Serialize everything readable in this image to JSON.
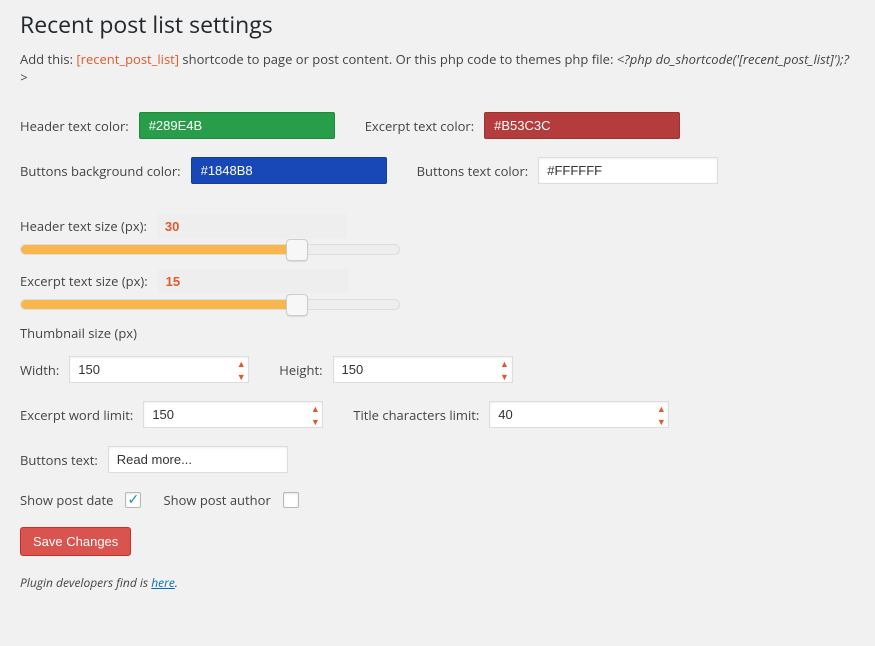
{
  "page": {
    "title": "Recent post list settings",
    "intro_prefix": "Add this: ",
    "intro_shortcode": "[recent_post_list]",
    "intro_mid": " shortcode to page or post content. Or this php code to themes php file: ",
    "intro_php": "<?php do_shortcode('[recent_post_list]');?>"
  },
  "labels": {
    "header_text_color": "Header text color:",
    "excerpt_text_color": "Excerpt text color:",
    "buttons_bg_color": "Buttons background color:",
    "buttons_text_color": "Buttons text color:",
    "header_text_size": "Header text size (px):",
    "excerpt_text_size": "Excerpt text size (px):",
    "thumbnail_size": "Thumbnail size (px)",
    "width": "Width:",
    "height": "Height:",
    "excerpt_word_limit": "Excerpt word limit:",
    "title_chars_limit": "Title characters limit:",
    "buttons_text": "Buttons text:",
    "show_post_date": "Show post date",
    "show_post_author": "Show post author",
    "save": "Save Changes"
  },
  "values": {
    "header_text_color": "#289E4B",
    "excerpt_text_color": "#B53C3C",
    "buttons_bg_color": "#1848B8",
    "buttons_text_color": "#FFFFFF",
    "header_text_size": "30",
    "excerpt_text_size": "15",
    "thumb_width": "150",
    "thumb_height": "150",
    "excerpt_word_limit": "150",
    "title_chars_limit": "40",
    "buttons_text": "Read more...",
    "show_post_date": true,
    "show_post_author": false
  },
  "slider": {
    "header_pct": 73,
    "excerpt_pct": 73
  },
  "footer": {
    "prefix": "Plugin developers find is ",
    "link": "here",
    "suffix": "."
  }
}
